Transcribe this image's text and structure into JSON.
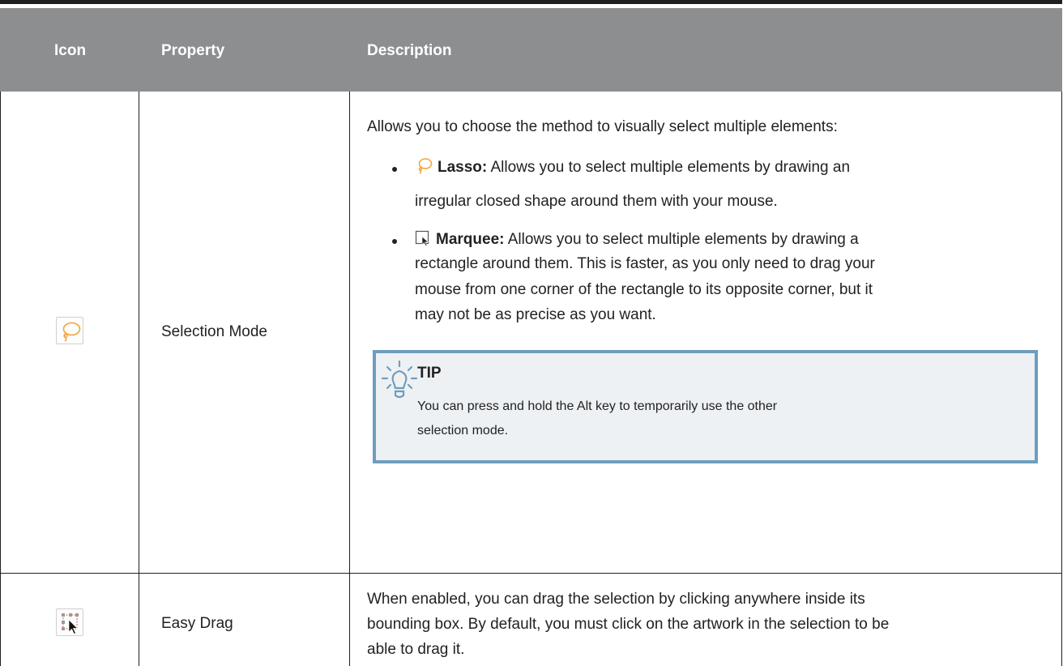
{
  "table": {
    "headers": {
      "icon": "Icon",
      "property": "Property",
      "description": "Description"
    },
    "rows": [
      {
        "property": "Selection Mode",
        "icon": "lasso-icon",
        "description": {
          "intro": "Allows you to choose the method to visually select multiple elements:",
          "bullets": [
            {
              "icon": "lasso-icon",
              "term": "Lasso:",
              "line1": " Allows you to select multiple elements by drawing an",
              "line2": "irregular closed shape around them with your mouse."
            },
            {
              "icon": "marquee-icon",
              "term": "Marquee:",
              "line1": " Allows you to select multiple elements by drawing a",
              "line2": "rectangle around them. This is faster, as you only need to drag your",
              "line3": "mouse from one corner of the rectangle to its opposite corner, but it",
              "line4": "may not be as precise as you want."
            }
          ],
          "tip": {
            "icon": "lightbulb-icon",
            "title": "TIP",
            "line1": "You can press and hold the Alt key to temporarily use the other",
            "line2": "selection mode."
          }
        }
      },
      {
        "property": "Easy Drag",
        "icon": "easy-drag-icon",
        "description": {
          "line1": "When enabled, you can drag the selection by clicking anywhere inside its",
          "line2": "bounding box. By default, you must click on the artwork in the selection to be",
          "line3": "able to drag it."
        }
      }
    ]
  },
  "colors": {
    "header_bg": "#8d8e90",
    "lasso": "#f5a23c",
    "tip_border": "#6f9dbd",
    "tip_bg": "#eef1f4",
    "marquee_handles": "#e06030"
  }
}
